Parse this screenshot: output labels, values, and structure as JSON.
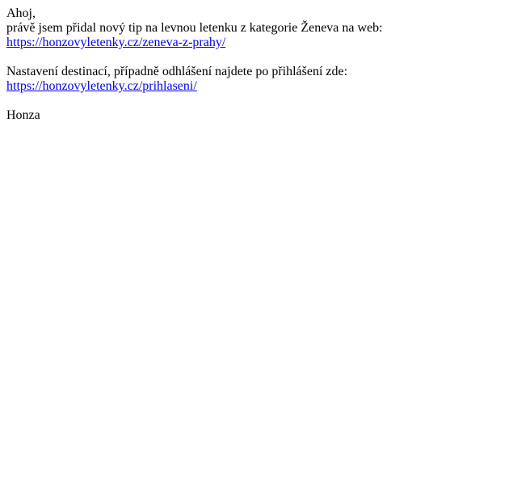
{
  "email": {
    "greeting": "Ahoj,",
    "intro": "právě jsem přidal nový tip na levnou letenku z kategorie Ženeva na web:",
    "tip_link": {
      "text": "https://honzovyletenky.cz/zeneva-z-prahy/",
      "href": "https://honzovyletenky.cz/zeneva-z-prahy/"
    },
    "settings_text": "Nastavení destinací, případně odhlášení najdete po přihlášení zde:",
    "login_link": {
      "text": "https://honzovyletenky.cz/prihlaseni/",
      "href": "https://honzovyletenky.cz/prihlaseni/"
    },
    "signature": "Honza"
  },
  "colors": {
    "link": "#0000ee",
    "text": "#000000",
    "background": "#ffffff"
  }
}
